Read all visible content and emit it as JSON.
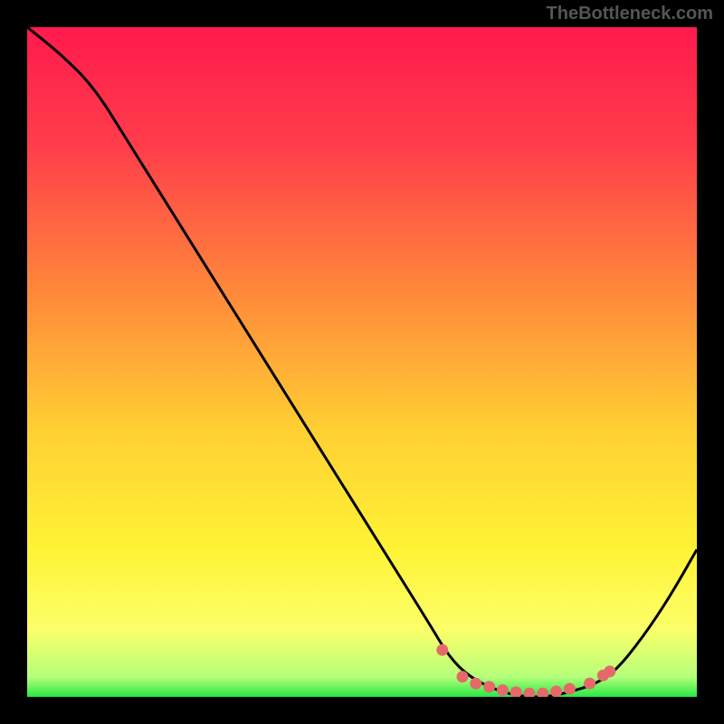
{
  "watermark": "TheBottleneck.com",
  "chart_data": {
    "type": "line",
    "title": "",
    "xlabel": "",
    "ylabel": "",
    "xlim": [
      0,
      100
    ],
    "ylim": [
      0,
      100
    ],
    "grid": false,
    "series": [
      {
        "name": "curve",
        "x": [
          0,
          5,
          10,
          15,
          20,
          25,
          30,
          35,
          40,
          45,
          50,
          55,
          60,
          63,
          66,
          70,
          74,
          78,
          82,
          85,
          88,
          92,
          96,
          100
        ],
        "y": [
          100,
          96,
          91,
          83,
          75,
          67,
          59,
          51,
          43,
          35,
          27,
          19,
          11,
          6,
          3,
          1,
          0,
          0,
          1,
          2,
          4,
          9,
          15,
          22
        ]
      }
    ],
    "markers": {
      "x": [
        62,
        65,
        67,
        69,
        71,
        73,
        75,
        77,
        79,
        81,
        84,
        86,
        87
      ],
      "y": [
        7,
        3,
        2,
        1.5,
        1,
        0.7,
        0.5,
        0.5,
        0.8,
        1.2,
        2,
        3.2,
        3.8
      ]
    },
    "gradient_stops": [
      {
        "offset": 0.0,
        "color": "#ff1a4d"
      },
      {
        "offset": 0.18,
        "color": "#ff3e4a"
      },
      {
        "offset": 0.4,
        "color": "#ff8a3a"
      },
      {
        "offset": 0.6,
        "color": "#ffcf33"
      },
      {
        "offset": 0.78,
        "color": "#fff336"
      },
      {
        "offset": 0.9,
        "color": "#fbff6a"
      },
      {
        "offset": 0.97,
        "color": "#b6ff7a"
      },
      {
        "offset": 1.0,
        "color": "#27e845"
      }
    ],
    "curve_color": "#000000",
    "marker_color": "#e46a6a"
  }
}
